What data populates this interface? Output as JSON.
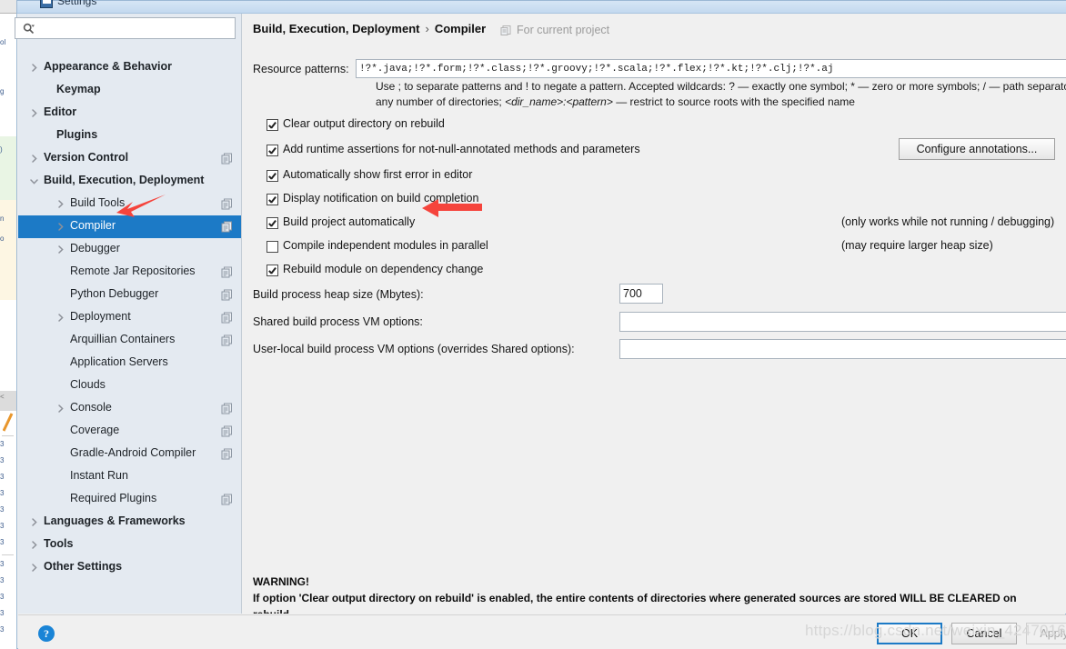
{
  "window": {
    "title": "Settings",
    "icon": "settings-window-icon"
  },
  "search": {
    "value": "",
    "placeholder": "",
    "icon": "search-icon"
  },
  "sidebar": {
    "items": [
      {
        "label": "Appearance & Behavior",
        "indent": 28,
        "bold": true,
        "twisty": "chevron-right",
        "project": false,
        "selected": false
      },
      {
        "label": "Keymap",
        "indent": 42,
        "bold": true,
        "twisty": "none",
        "project": false,
        "selected": false
      },
      {
        "label": "Editor",
        "indent": 28,
        "bold": true,
        "twisty": "chevron-right",
        "project": false,
        "selected": false
      },
      {
        "label": "Plugins",
        "indent": 42,
        "bold": true,
        "twisty": "none",
        "project": false,
        "selected": false
      },
      {
        "label": "Version Control",
        "indent": 28,
        "bold": true,
        "twisty": "chevron-right",
        "project": true,
        "selected": false
      },
      {
        "label": "Build, Execution, Deployment",
        "indent": 28,
        "bold": true,
        "twisty": "chevron-down",
        "project": false,
        "selected": false
      },
      {
        "label": "Build Tools",
        "indent": 57,
        "bold": false,
        "twisty": "chevron-right",
        "project": true,
        "selected": false
      },
      {
        "label": "Compiler",
        "indent": 57,
        "bold": false,
        "twisty": "chevron-right",
        "project": true,
        "selected": true
      },
      {
        "label": "Debugger",
        "indent": 57,
        "bold": false,
        "twisty": "chevron-right",
        "project": false,
        "selected": false
      },
      {
        "label": "Remote Jar Repositories",
        "indent": 57,
        "bold": false,
        "twisty": "none",
        "project": true,
        "selected": false
      },
      {
        "label": "Python Debugger",
        "indent": 57,
        "bold": false,
        "twisty": "none",
        "project": true,
        "selected": false
      },
      {
        "label": "Deployment",
        "indent": 57,
        "bold": false,
        "twisty": "chevron-right",
        "project": true,
        "selected": false
      },
      {
        "label": "Arquillian Containers",
        "indent": 57,
        "bold": false,
        "twisty": "none",
        "project": true,
        "selected": false
      },
      {
        "label": "Application Servers",
        "indent": 57,
        "bold": false,
        "twisty": "none",
        "project": false,
        "selected": false
      },
      {
        "label": "Clouds",
        "indent": 57,
        "bold": false,
        "twisty": "none",
        "project": false,
        "selected": false
      },
      {
        "label": "Console",
        "indent": 57,
        "bold": false,
        "twisty": "chevron-right",
        "project": true,
        "selected": false
      },
      {
        "label": "Coverage",
        "indent": 57,
        "bold": false,
        "twisty": "none",
        "project": true,
        "selected": false
      },
      {
        "label": "Gradle-Android Compiler",
        "indent": 57,
        "bold": false,
        "twisty": "none",
        "project": true,
        "selected": false
      },
      {
        "label": "Instant Run",
        "indent": 57,
        "bold": false,
        "twisty": "none",
        "project": false,
        "selected": false
      },
      {
        "label": "Required Plugins",
        "indent": 57,
        "bold": false,
        "twisty": "none",
        "project": true,
        "selected": false
      },
      {
        "label": "Languages & Frameworks",
        "indent": 28,
        "bold": true,
        "twisty": "chevron-right",
        "project": false,
        "selected": false
      },
      {
        "label": "Tools",
        "indent": 28,
        "bold": true,
        "twisty": "chevron-right",
        "project": false,
        "selected": false
      },
      {
        "label": "Other Settings",
        "indent": 28,
        "bold": true,
        "twisty": "chevron-right",
        "project": false,
        "selected": false
      }
    ]
  },
  "main": {
    "breadcrumb_root": "Build, Execution, Deployment",
    "breadcrumb_sep": "›",
    "breadcrumb_leaf": "Compiler",
    "scope_label": "For current project",
    "scope_icon": "project-scope-icon",
    "resource_patterns_label": "Resource patterns:",
    "resource_patterns_value": "!?*.java;!?*.form;!?*.class;!?*.groovy;!?*.scala;!?*.flex;!?*.kt;!?*.clj;!?*.aj",
    "hint_line1": "Use ; to separate patterns and ! to negate a pattern. Accepted wildcards: ? — exactly one symbol; * — zero or more symbols; / — path separator; /**",
    "hint_line2_a": "any number of directories;",
    "hint_line2_i": "<dir_name>:<pattern>",
    "hint_line2_b": "— restrict to source roots with the specified name",
    "checkboxes": [
      {
        "label": "Clear output directory on rebuild",
        "checked": true,
        "note": ""
      },
      {
        "label": "Add runtime assertions for not-null-annotated methods and parameters",
        "checked": true,
        "note": ""
      },
      {
        "label": "Automatically show first error in editor",
        "checked": true,
        "note": ""
      },
      {
        "label": "Display notification on build completion",
        "checked": true,
        "note": ""
      },
      {
        "label": "Build project automatically",
        "checked": true,
        "note": "(only works while not running / debugging)"
      },
      {
        "label": "Compile independent modules in parallel",
        "checked": false,
        "note": "(may require larger heap size)"
      },
      {
        "label": "Rebuild module on dependency change",
        "checked": true,
        "note": ""
      }
    ],
    "configure_annotations_label": "Configure annotations...",
    "heap_label": "Build process heap size (Mbytes):",
    "heap_value": "700",
    "shared_vm_label": "Shared build process VM options:",
    "shared_vm_value": "",
    "user_vm_label": "User-local build process VM options (overrides Shared options):",
    "user_vm_value": "",
    "warning_title": "WARNING!",
    "warning_line1": "If option 'Clear output directory on rebuild' is enabled, the entire contents of directories where generated sources are stored WILL BE CLEARED on",
    "warning_line2": "rebuild."
  },
  "footer": {
    "help_label": "?",
    "ok_label": "OK",
    "cancel_label": "Cancel",
    "apply_label": "Apply"
  },
  "overlay": {
    "watermark": "https://blog.csdn.net/weixin_42470164",
    "arrow_color": "#f5443c"
  },
  "colors": {
    "selection": "#1c7ac6",
    "panel": "#e4eaf1",
    "content": "#f0f0f0",
    "titlebar": "#c9dcef"
  }
}
